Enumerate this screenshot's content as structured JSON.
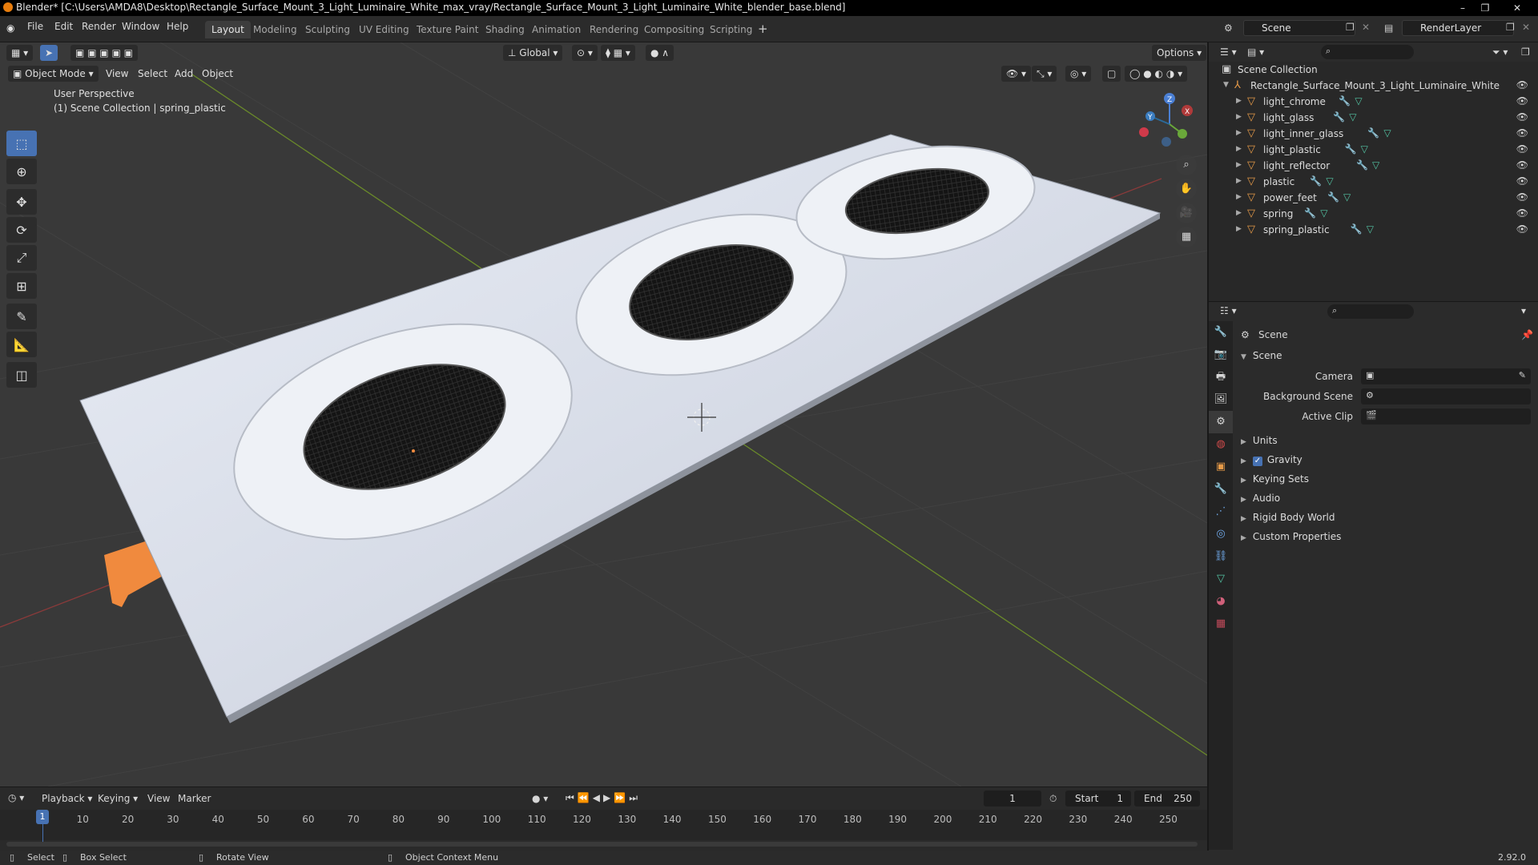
{
  "window": {
    "title": "Blender* [C:\\Users\\AMDA8\\Desktop\\Rectangle_Surface_Mount_3_Light_Luminaire_White_max_vray/Rectangle_Surface_Mount_3_Light_Luminaire_White_blender_base.blend]",
    "minimize": "–",
    "maximize": "❐",
    "close": "✕"
  },
  "menu": [
    "File",
    "Edit",
    "Render",
    "Window",
    "Help"
  ],
  "workspaces": [
    "Layout",
    "Modeling",
    "Sculpting",
    "UV Editing",
    "Texture Paint",
    "Shading",
    "Animation",
    "Rendering",
    "Compositing",
    "Scripting"
  ],
  "scene_field": "Scene",
  "renderlayer_field": "RenderLayer",
  "viewport": {
    "mode": "Object Mode",
    "menus": [
      "View",
      "Select",
      "Add",
      "Object"
    ],
    "transform_orientation": "Global",
    "options": "Options",
    "perspective_label": "User Perspective",
    "collection_label": "(1) Scene Collection | spring_plastic",
    "gizmo_axes": {
      "x": "X",
      "y": "Y",
      "z": "Z"
    }
  },
  "outliner": {
    "root": "Scene Collection",
    "collection": "Rectangle_Surface_Mount_3_Light_Luminaire_White",
    "objects": [
      "light_chrome",
      "light_glass",
      "light_inner_glass",
      "light_plastic",
      "light_reflector",
      "plastic",
      "power_feet",
      "spring",
      "spring_plastic"
    ]
  },
  "properties": {
    "context": "Scene",
    "panel": "Scene",
    "camera_label": "Camera",
    "background_label": "Background Scene",
    "clip_label": "Active Clip",
    "subpanels": [
      "Units",
      "Gravity",
      "Keying Sets",
      "Audio",
      "Rigid Body World",
      "Custom Properties"
    ]
  },
  "timeline": {
    "menus": [
      "Playback",
      "Keying",
      "View",
      "Marker"
    ],
    "current_frame": "1",
    "start_label": "Start",
    "start_value": "1",
    "end_label": "End",
    "end_value": "250",
    "ticks": [
      "1",
      "10",
      "20",
      "30",
      "40",
      "50",
      "60",
      "70",
      "80",
      "90",
      "100",
      "110",
      "120",
      "130",
      "140",
      "150",
      "160",
      "170",
      "180",
      "190",
      "200",
      "210",
      "220",
      "230",
      "240",
      "250"
    ]
  },
  "statusbar": {
    "select": "Select",
    "box_select": "Box Select",
    "rotate": "Rotate View",
    "context_menu": "Object Context Menu",
    "version": "2.92.0"
  },
  "colors": {
    "accent": "#4772b3",
    "object_orange": "#e69a48",
    "viewport_bg": "#393939"
  }
}
